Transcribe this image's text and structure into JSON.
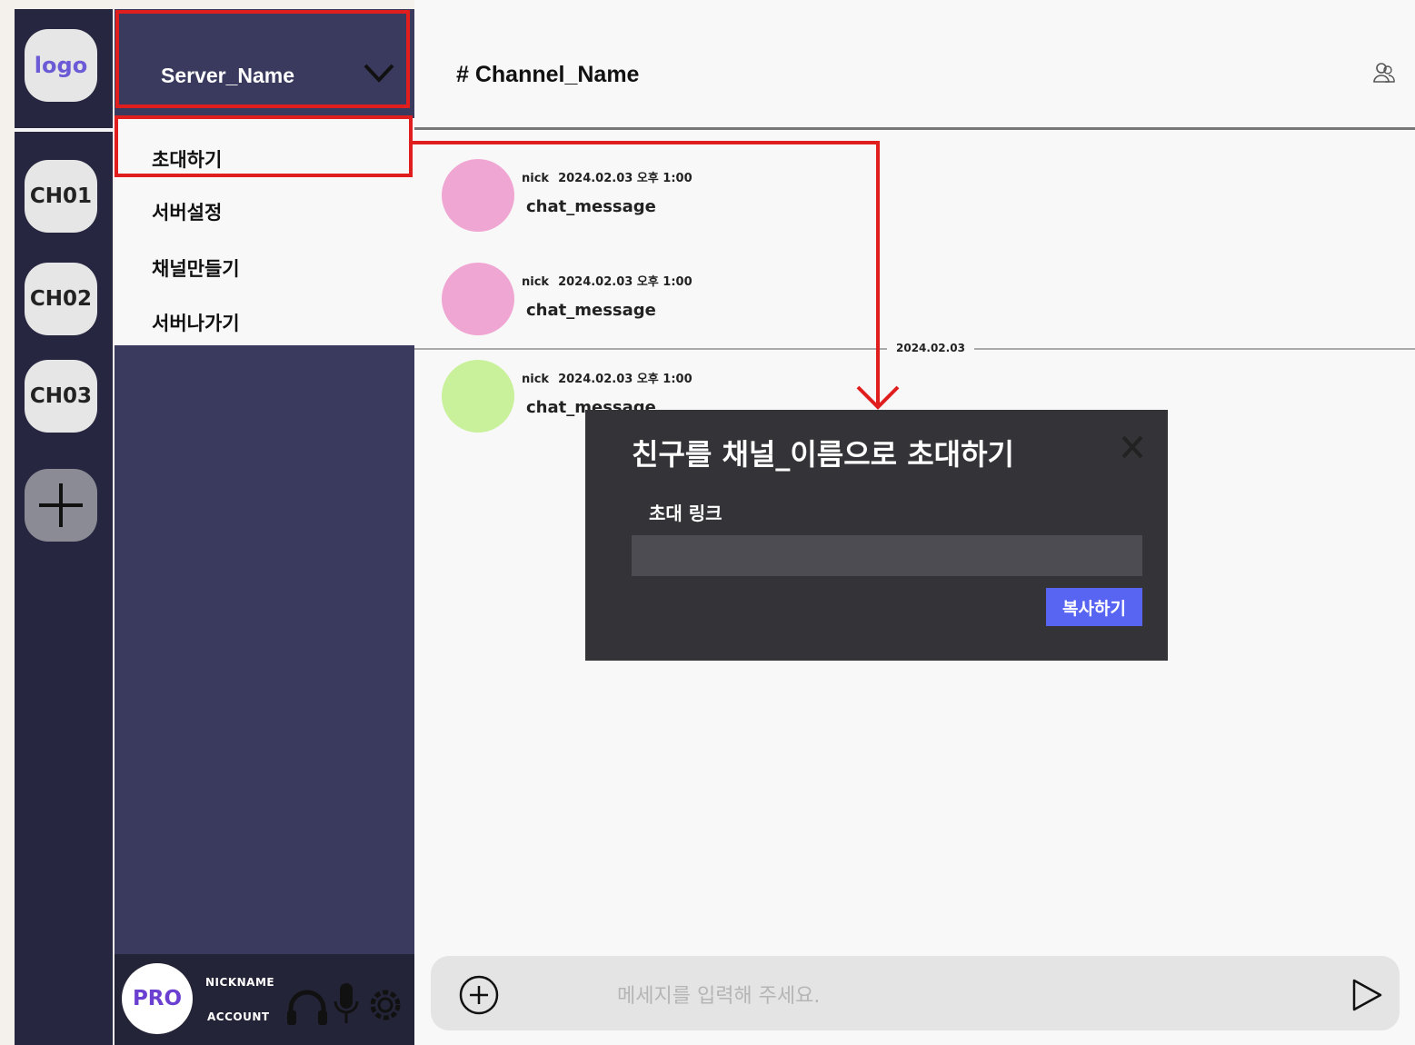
{
  "rail": {
    "logo": "logo",
    "channels": [
      "CH01",
      "CH02",
      "CH03"
    ]
  },
  "server": {
    "name": "Server_Name",
    "menu": [
      "초대하기",
      "서버설정",
      "채널만들기",
      "서버나가기"
    ]
  },
  "user": {
    "badge": "PRO",
    "nickname": "NICKNAME",
    "account": "ACCOUNT"
  },
  "channel": {
    "title": "# Channel_Name"
  },
  "messages": [
    {
      "nick": "nick",
      "date": "2024.02.03 오후 1:00",
      "text": "chat_message",
      "avatar_color": "#f0a6d2"
    },
    {
      "nick": "nick",
      "date": "2024.02.03 오후 1:00",
      "text": "chat_message",
      "avatar_color": "#f0a6d2"
    },
    {
      "nick": "nick",
      "date": "2024.02.03 오후 1:00",
      "text": "chat_message",
      "avatar_color": "#c9f09a"
    }
  ],
  "date_divider": "2024.02.03",
  "modal": {
    "title": "친구를 채널_이름으로 초대하기",
    "label": "초대 링크",
    "copy_button": "복사하기"
  },
  "chat_input": {
    "placeholder": "메세지를 입력해 주세요."
  },
  "colors": {
    "highlight": "#e01e1e",
    "accent": "#5865f2",
    "sidebar": "#3a3a5f",
    "rail": "#262640"
  }
}
